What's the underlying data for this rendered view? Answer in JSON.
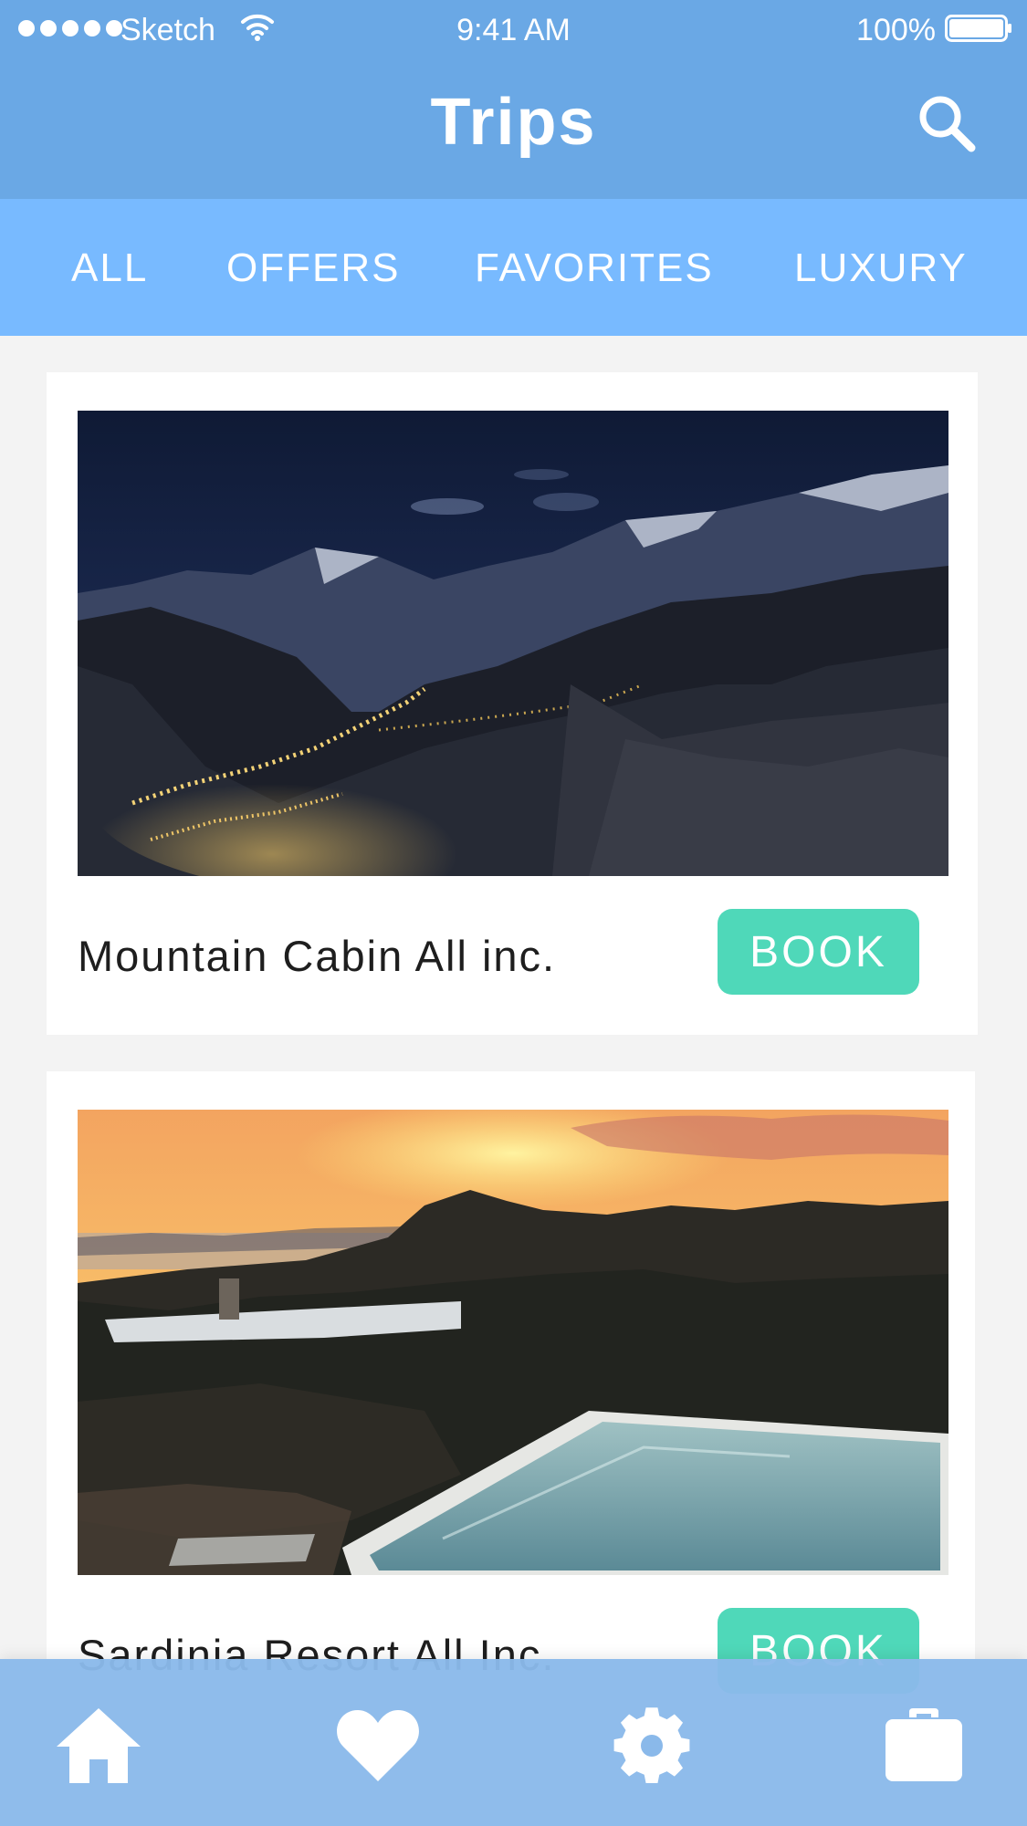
{
  "status_bar": {
    "carrier": "Sketch",
    "time": "9:41 AM",
    "battery": "100%",
    "icons": [
      "signal-dots-icon",
      "wifi-icon",
      "battery-icon"
    ]
  },
  "header": {
    "title": "Trips",
    "search_icon": "search-icon"
  },
  "tabs": [
    {
      "label": "ALL"
    },
    {
      "label": "OFFERS"
    },
    {
      "label": "FAVORITES"
    },
    {
      "label": "LUXURY"
    }
  ],
  "trips": [
    {
      "title": "Mountain Cabin All inc.",
      "book_label": "BOOK",
      "photo": "night mountain valley with village lights"
    },
    {
      "title": "Sardinia Resort All Inc.",
      "book_label": "BOOK",
      "photo": "sunset over hills with infinity pool"
    }
  ],
  "bottom_nav": {
    "items": [
      "home-icon",
      "heart-icon",
      "gear-icon",
      "briefcase-icon"
    ]
  },
  "colors": {
    "header_bg": "#6aa8e5",
    "tabs_bg": "#78baff",
    "book_button": "#4fd8b9",
    "bottom_bar": "#8ab9ea",
    "page_bg": "#f3f3f3"
  }
}
